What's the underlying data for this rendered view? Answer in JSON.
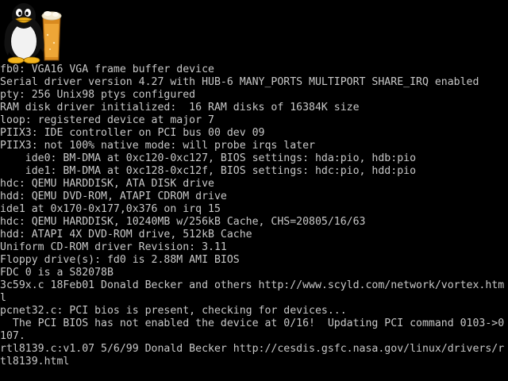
{
  "colors": {
    "background": "#000000",
    "console_text": "#c8c8c8"
  },
  "boot_logo": {
    "icon": "tux-penguin-with-beer-logo"
  },
  "console": {
    "lines": [
      "fb0: VGA16 VGA frame buffer device",
      "Serial driver version 4.27 with HUB-6 MANY_PORTS MULTIPORT SHARE_IRQ enabled",
      "pty: 256 Unix98 ptys configured",
      "RAM disk driver initialized:  16 RAM disks of 16384K size",
      "loop: registered device at major 7",
      "PIIX3: IDE controller on PCI bus 00 dev 09",
      "PIIX3: not 100% native mode: will probe irqs later",
      "    ide0: BM-DMA at 0xc120-0xc127, BIOS settings: hda:pio, hdb:pio",
      "    ide1: BM-DMA at 0xc128-0xc12f, BIOS settings: hdc:pio, hdd:pio",
      "hdc: QEMU HARDDISK, ATA DISK drive",
      "hdd: QEMU DVD-ROM, ATAPI CDROM drive",
      "ide1 at 0x170-0x177,0x376 on irq 15",
      "hdc: QEMU HARDDISK, 10240MB w/256kB Cache, CHS=20805/16/63",
      "hdd: ATAPI 4X DVD-ROM drive, 512kB Cache",
      "Uniform CD-ROM driver Revision: 3.11",
      "Floppy drive(s): fd0 is 2.88M AMI BIOS",
      "FDC 0 is a S82078B",
      "3c59x.c 18Feb01 Donald Becker and others http://www.scyld.com/network/vortex.htm",
      "l",
      "pcnet32.c: PCI bios is present, checking for devices...",
      "  The PCI BIOS has not enabled the device at 0/16!  Updating PCI command 0103->0",
      "107.",
      "rtl8139.c:v1.07 5/6/99 Donald Becker http://cesdis.gsfc.nasa.gov/linux/drivers/r",
      "tl8139.html"
    ]
  }
}
